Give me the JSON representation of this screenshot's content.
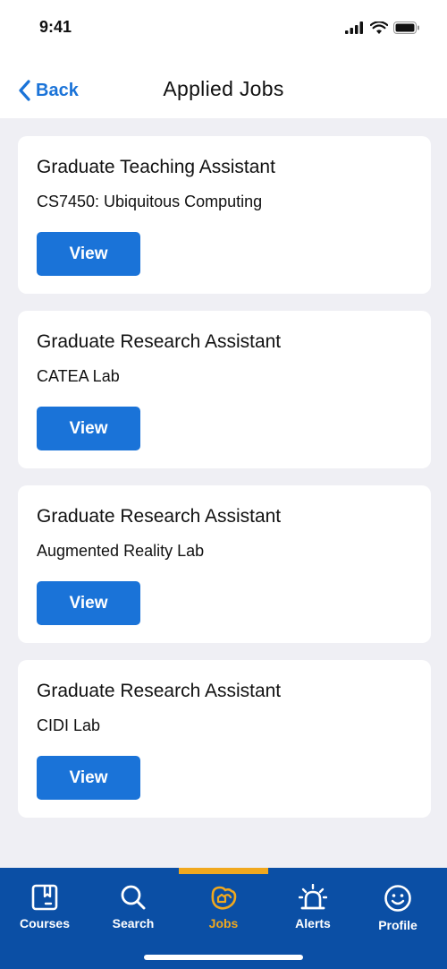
{
  "status_bar": {
    "time": "9:41"
  },
  "nav": {
    "back_label": "Back",
    "title": "Applied Jobs"
  },
  "jobs": [
    {
      "title": "Graduate Teaching Assistant",
      "subtitle": "CS7450: Ubiquitous Computing",
      "button_label": "View"
    },
    {
      "title": "Graduate Research Assistant",
      "subtitle": "CATEA Lab",
      "button_label": "View"
    },
    {
      "title": "Graduate Research Assistant",
      "subtitle": "Augmented Reality Lab",
      "button_label": "View"
    },
    {
      "title": "Graduate Research Assistant",
      "subtitle": "CIDI Lab",
      "button_label": "View"
    }
  ],
  "tabs": [
    {
      "label": "Courses",
      "icon": "courses-icon",
      "active": false
    },
    {
      "label": "Search",
      "icon": "search-icon",
      "active": false
    },
    {
      "label": "Jobs",
      "icon": "jobs-icon",
      "active": true
    },
    {
      "label": "Alerts",
      "icon": "alerts-icon",
      "active": false
    },
    {
      "label": "Profile",
      "icon": "profile-icon",
      "active": false
    }
  ],
  "colors": {
    "accent": "#1a73d8",
    "tab_bar": "#0b4fa5",
    "active_tab": "#f0a81e",
    "background": "#efeff4"
  }
}
